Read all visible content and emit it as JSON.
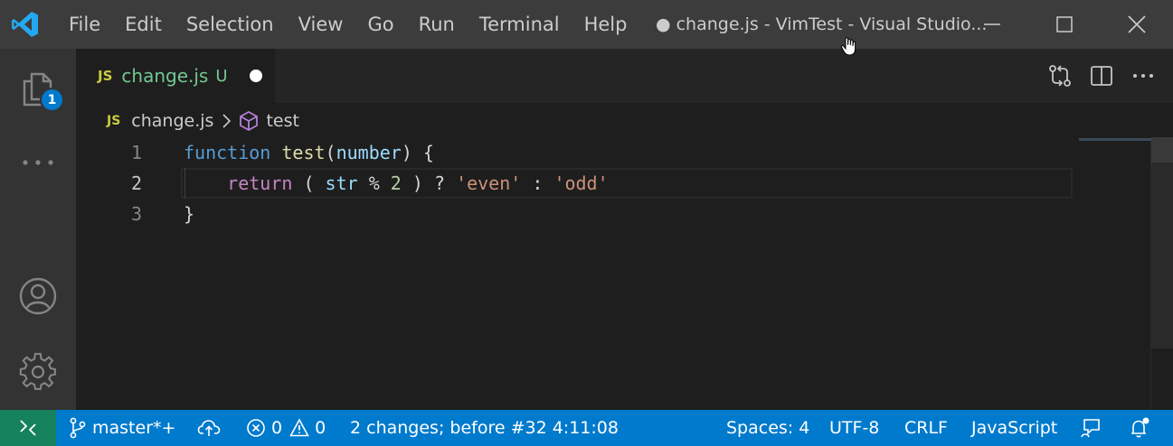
{
  "titlebar": {
    "menu": [
      "File",
      "Edit",
      "Selection",
      "View",
      "Go",
      "Run",
      "Terminal",
      "Help"
    ],
    "window_title": "● change.js - VimTest - Visual Studio..."
  },
  "activity_bar": {
    "explorer_badge": "1"
  },
  "tab": {
    "icon_label": "JS",
    "title": "change.js",
    "status": "U"
  },
  "breadcrumb": {
    "icon_label": "JS",
    "file": "change.js",
    "symbol": "test"
  },
  "editor": {
    "lines": [
      {
        "number": "1",
        "tokens": [
          {
            "t": "function",
            "c": "kw"
          },
          {
            "t": " ",
            "c": "punc"
          },
          {
            "t": "test",
            "c": "fn"
          },
          {
            "t": "(",
            "c": "punc"
          },
          {
            "t": "number",
            "c": "param"
          },
          {
            "t": ") {",
            "c": "punc"
          }
        ]
      },
      {
        "number": "2",
        "tokens": [
          {
            "t": "    ",
            "c": "punc"
          },
          {
            "t": "return",
            "c": "ctl"
          },
          {
            "t": " ( ",
            "c": "punc"
          },
          {
            "t": "str",
            "c": "var"
          },
          {
            "t": " % ",
            "c": "punc"
          },
          {
            "t": "2",
            "c": "num"
          },
          {
            "t": " ) ? ",
            "c": "punc"
          },
          {
            "t": "'even'",
            "c": "str"
          },
          {
            "t": " : ",
            "c": "punc"
          },
          {
            "t": "'odd'",
            "c": "str"
          }
        ]
      },
      {
        "number": "3",
        "tokens": [
          {
            "t": "}",
            "c": "punc"
          }
        ]
      }
    ],
    "active_line": 2
  },
  "statusbar": {
    "branch": "master*+",
    "errors": "0",
    "warnings": "0",
    "message": "2 changes; before #32  4:11:08",
    "spaces": "Spaces: 4",
    "encoding": "UTF-8",
    "eol": "CRLF",
    "language": "JavaScript"
  },
  "colors": {
    "statusbar_bg": "#007acc",
    "remote_bg": "#16825d",
    "tab_untracked": "#73c991",
    "js_icon": "#cbcb41"
  }
}
